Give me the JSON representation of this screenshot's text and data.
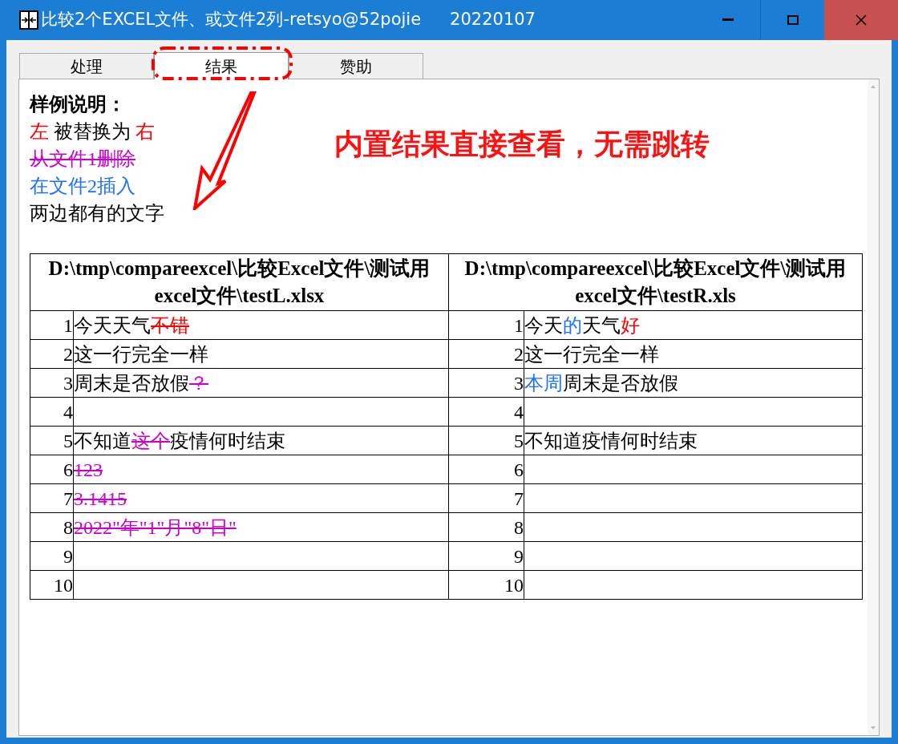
{
  "window": {
    "title": "比较2个EXCEL文件、或文件2列-retsyo@52pojie",
    "version": "20220107"
  },
  "tabs": [
    {
      "label": "处理",
      "selected": false
    },
    {
      "label": "结果",
      "selected": true
    },
    {
      "label": "赞助",
      "selected": false
    }
  ],
  "legend": {
    "title": "样例说明：",
    "lines": [
      [
        {
          "kind": "changed",
          "text": "左"
        },
        {
          "kind": "plain",
          "text": " 被替换为 "
        },
        {
          "kind": "changed",
          "text": "右"
        }
      ],
      [
        {
          "kind": "deleted",
          "text": "从文件1删除"
        }
      ],
      [
        {
          "kind": "inserted",
          "text": "在文件2插入"
        }
      ],
      [
        {
          "kind": "plain",
          "text": "两边都有的文字"
        }
      ]
    ]
  },
  "annotation": {
    "text": "内置结果直接查看，无需跳转"
  },
  "table": {
    "columns": [
      "D:\\tmp\\compareexcel\\比较Excel文件\\测试用excel文件\\testL.xlsx",
      "D:\\tmp\\compareexcel\\比较Excel文件\\测试用excel文件\\testR.xls"
    ],
    "rows": [
      {
        "left_num": "1",
        "left": [
          {
            "kind": "plain",
            "text": "今天天气"
          },
          {
            "kind": "changed_struck",
            "text": "不错"
          }
        ],
        "right_num": "1",
        "right": [
          {
            "kind": "plain",
            "text": "今天"
          },
          {
            "kind": "inserted",
            "text": "的"
          },
          {
            "kind": "plain",
            "text": "天气"
          },
          {
            "kind": "changed",
            "text": "好"
          }
        ]
      },
      {
        "left_num": "2",
        "left": [
          {
            "kind": "plain",
            "text": "这一行完全一样"
          }
        ],
        "right_num": "2",
        "right": [
          {
            "kind": "plain",
            "text": "这一行完全一样"
          }
        ]
      },
      {
        "left_num": "3",
        "left": [
          {
            "kind": "plain",
            "text": "周末是否放假"
          },
          {
            "kind": "deleted",
            "text": "？"
          }
        ],
        "right_num": "3",
        "right": [
          {
            "kind": "inserted",
            "text": "本周"
          },
          {
            "kind": "plain",
            "text": "周末是否放假"
          }
        ]
      },
      {
        "left_num": "4",
        "left": [],
        "right_num": "4",
        "right": []
      },
      {
        "left_num": "5",
        "left": [
          {
            "kind": "plain",
            "text": "不知道"
          },
          {
            "kind": "deleted",
            "text": "这个"
          },
          {
            "kind": "plain",
            "text": "疫情何时结束"
          }
        ],
        "right_num": "5",
        "right": [
          {
            "kind": "plain",
            "text": "不知道疫情何时结束"
          }
        ]
      },
      {
        "left_num": "6",
        "left": [
          {
            "kind": "deleted",
            "text": "123"
          }
        ],
        "right_num": "6",
        "right": []
      },
      {
        "left_num": "7",
        "left": [
          {
            "kind": "deleted",
            "text": "3.1415"
          }
        ],
        "right_num": "7",
        "right": []
      },
      {
        "left_num": "8",
        "left": [
          {
            "kind": "deleted",
            "text": "2022\"年\"1\"月\"8\"日\""
          }
        ],
        "right_num": "8",
        "right": []
      },
      {
        "left_num": "9",
        "left": [],
        "right_num": "9",
        "right": []
      },
      {
        "left_num": "10",
        "left": [],
        "right_num": "10",
        "right": []
      }
    ]
  }
}
